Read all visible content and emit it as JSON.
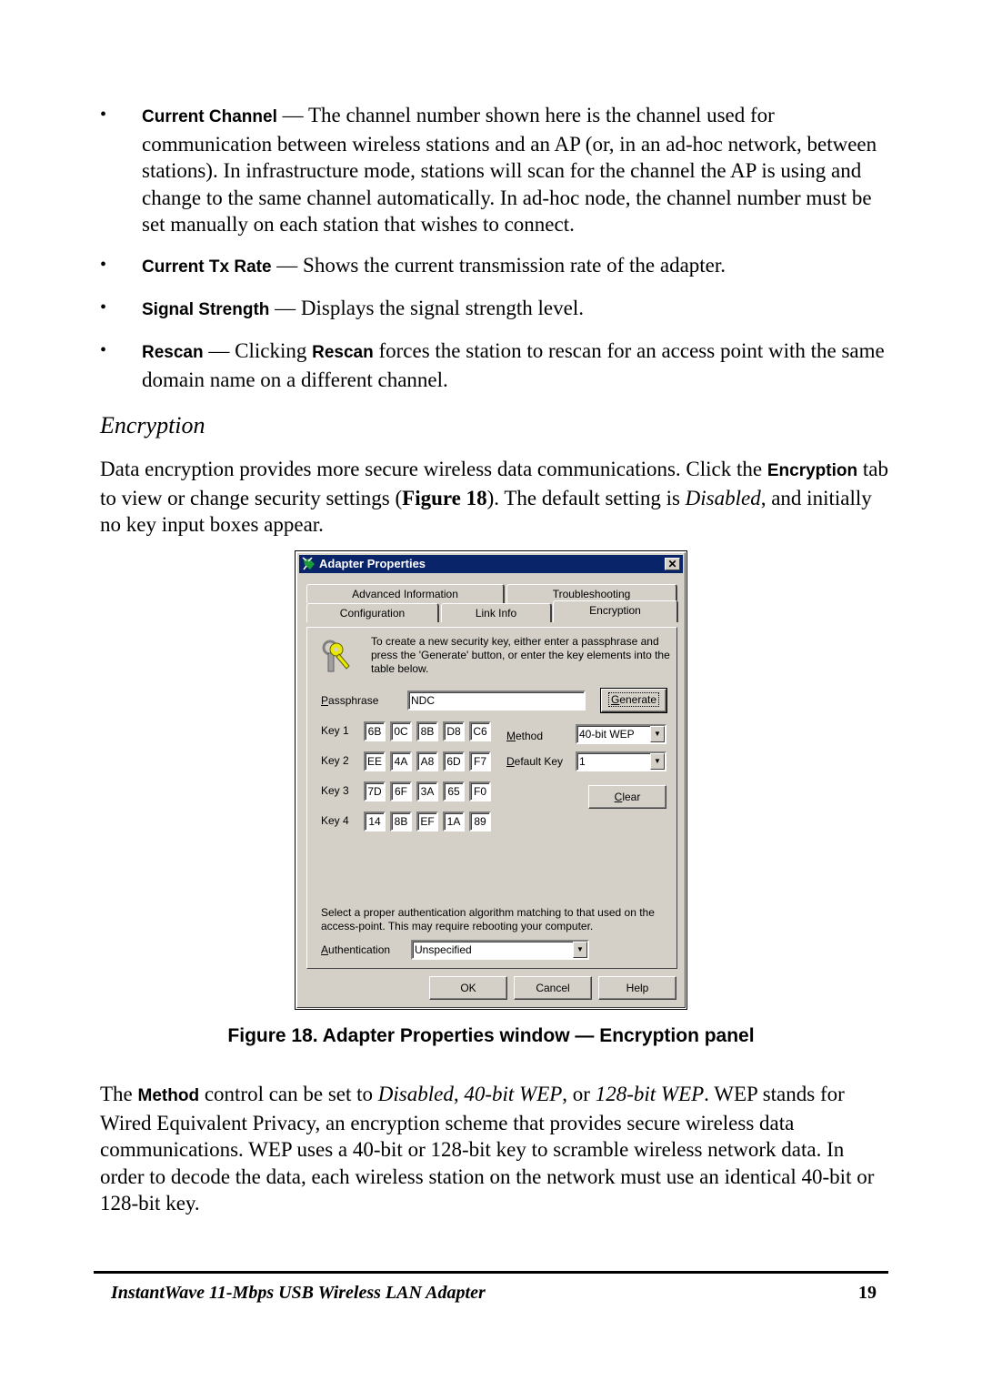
{
  "bullets": [
    {
      "term": "Current Channel",
      "text": " — The channel number shown here is the channel used for communication between wireless stations and an AP (or, in an ad-hoc network, between stations). In infrastructure mode, stations will scan for the channel the AP is using and change to the same channel automatically. In ad-hoc node, the channel number must be set manually on each station that wishes to connect."
    },
    {
      "term": "Current Tx Rate",
      "text": " — Shows the current transmission rate of the adapter."
    },
    {
      "term": "Signal Strength",
      "text": " — Displays the signal strength level."
    },
    {
      "term": "Rescan",
      "text_a": " — Clicking ",
      "term2": "Rescan",
      "text_b": " forces the station to rescan for an access point with the same domain name on a different channel."
    }
  ],
  "bullet_glyph": "•",
  "section": {
    "heading": "Encryption",
    "intro_a": "Data encryption provides more secure wireless data communications. Click the ",
    "intro_term": "Encryption",
    "intro_b": " tab to view or change security settings (",
    "intro_fig": "Figure 18",
    "intro_c": "). The default setting is ",
    "intro_italic": "Disabled",
    "intro_d": ", and initially no key input boxes appear."
  },
  "dialog": {
    "title": "Adapter Properties",
    "close_glyph": "✕",
    "tabs": [
      "Advanced Information",
      "Troubleshooting",
      "Configuration",
      "Link Info",
      "Encryption"
    ],
    "active_tab": "Encryption",
    "instructions": "To create a new security key, either enter a passphrase and press the 'Generate' button, or enter the key elements into the table below.",
    "passphrase_label_u": "P",
    "passphrase_label_rest": "assphrase",
    "passphrase_value": "NDC",
    "generate_u": "G",
    "generate_rest": "enerate",
    "keys": [
      {
        "label": "Key 1",
        "values": [
          "6B",
          "0C",
          "8B",
          "D8",
          "C6"
        ]
      },
      {
        "label": "Key 2",
        "values": [
          "EE",
          "4A",
          "A8",
          "6D",
          "F7"
        ]
      },
      {
        "label": "Key 3",
        "values": [
          "7D",
          "6F",
          "3A",
          "65",
          "F0"
        ]
      },
      {
        "label": "Key 4",
        "values": [
          "14",
          "8B",
          "EF",
          "1A",
          "89"
        ]
      }
    ],
    "method_label_u": "M",
    "method_label_rest": "ethod",
    "method_value": "40-bit WEP",
    "default_key_label_u": "D",
    "default_key_label_rest": "efault Key",
    "default_key_value": "1",
    "clear_u": "C",
    "clear_rest": "lear",
    "auth_note": "Select a proper authentication algorithm matching to that used on the access-point. This may require rebooting your computer.",
    "auth_label_u": "A",
    "auth_label_rest": "uthentication",
    "auth_value": "Unspecified",
    "dropdown_glyph": "▼",
    "ok": "OK",
    "cancel": "Cancel",
    "help": "Help"
  },
  "caption": "Figure 18. Adapter Properties window — Encryption panel",
  "para2": {
    "a": "The ",
    "term": "Method",
    "b": " control can be set to ",
    "i1": "Disabled",
    "c": ", ",
    "i2": "40-bit WEP",
    "d": ", or ",
    "i3": "128-bit WEP",
    "e": ". WEP stands for Wired Equivalent Privacy, an encryption scheme that provides secure wireless data communications. WEP uses a 40-bit or 128-bit key to scramble wireless network data. In order to decode the data, each wireless station on the network must use an identical 40-bit or 128-bit key."
  },
  "footer": {
    "title_a": "InstantWave ",
    "title_b": "11-Mbps USB Wireless LAN Adapter",
    "page": "19"
  }
}
